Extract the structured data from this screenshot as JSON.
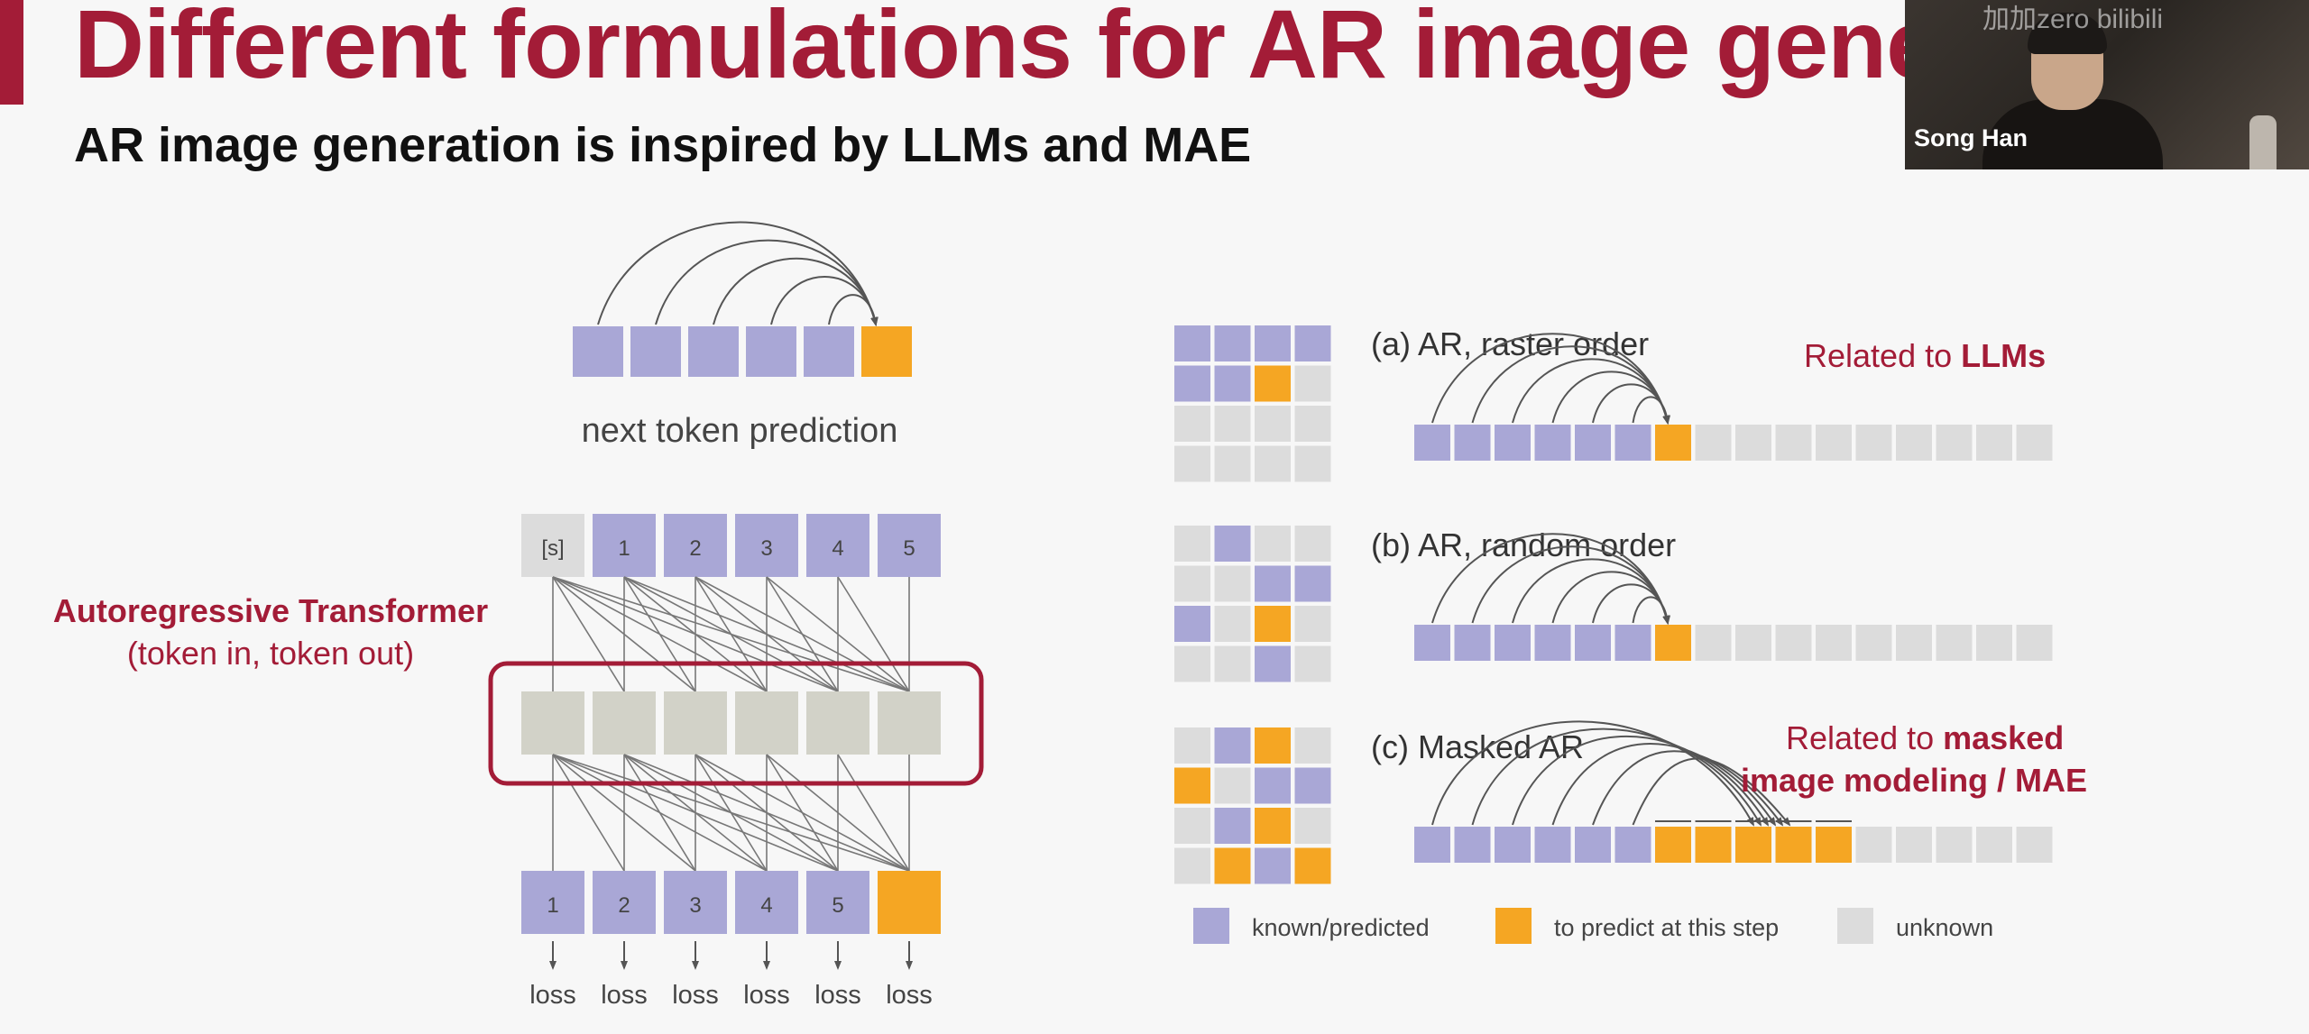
{
  "slide": {
    "title": "Different formulations for AR image gene",
    "subtitle": "AR image generation is inspired by LLMs and MAE"
  },
  "video": {
    "speaker_name": "Song Han",
    "watermark": "加加zero  bilibili"
  },
  "left_diagram": {
    "next_token_caption": "next token prediction",
    "input_tokens": [
      "[s]",
      "1",
      "2",
      "3",
      "4",
      "5"
    ],
    "output_tokens": [
      "1",
      "2",
      "3",
      "4",
      "5",
      ""
    ],
    "loss_labels": [
      "loss",
      "loss",
      "loss",
      "loss",
      "loss",
      "loss"
    ],
    "transformer_label": "Autoregressive Transformer",
    "transformer_sublabel": "(token in, token out)"
  },
  "right_diagram": {
    "rows": [
      {
        "label": "(a) AR, raster order",
        "grid": [
          "K",
          "K",
          "K",
          "K",
          "K",
          "K",
          "P",
          "U",
          "U",
          "U",
          "U",
          "U",
          "U",
          "U",
          "U",
          "U"
        ],
        "sequence_known": 6,
        "sequence_predict": 1,
        "sequence_unknown": 9
      },
      {
        "label": "(b) AR, random order",
        "grid": [
          "U",
          "K",
          "U",
          "U",
          "U",
          "U",
          "K",
          "K",
          "K",
          "U",
          "P",
          "U",
          "U",
          "U",
          "K",
          "U"
        ],
        "sequence_known": 6,
        "sequence_predict": 1,
        "sequence_unknown": 9
      },
      {
        "label": "(c) Masked AR",
        "grid": [
          "U",
          "K",
          "P",
          "U",
          "P",
          "U",
          "K",
          "K",
          "U",
          "K",
          "P",
          "U",
          "U",
          "P",
          "K",
          "P"
        ],
        "sequence_known": 6,
        "sequence_predict": 5,
        "sequence_unknown": 5
      }
    ],
    "related_llms_prefix": "Related to ",
    "related_llms_bold": "LLMs",
    "related_mae_prefix": "Related to ",
    "related_mae_bold_1": "masked",
    "related_mae_bold_2": "image modeling / MAE",
    "legend": {
      "known": "known/predicted",
      "predict": "to predict at this step",
      "unknown": "unknown"
    }
  },
  "colors": {
    "known": "#a9a7d6",
    "predict": "#f5a623",
    "unknown": "#dcdcdc",
    "layer": "#d2d2c8",
    "accent": "#a31c37"
  }
}
